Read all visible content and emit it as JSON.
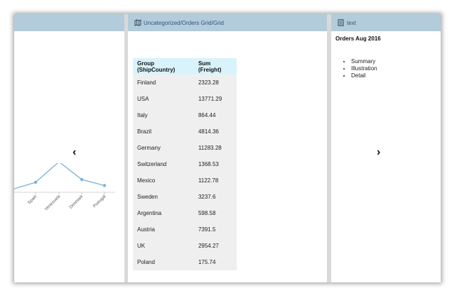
{
  "middle_panel": {
    "header_icon": "map-icon",
    "header_title": "Uncategorized/Orders Grid/Grid",
    "table": {
      "columns": [
        "Group (ShipCountry)",
        "Sum (Freight)"
      ],
      "rows": [
        [
          "Finland",
          "2323.28"
        ],
        [
          "USA",
          "13771.29"
        ],
        [
          "Italy",
          "864.44"
        ],
        [
          "Brazil",
          "4814.36"
        ],
        [
          "Germany",
          "11283.28"
        ],
        [
          "Switzerland",
          "1368.53"
        ],
        [
          "Mexico",
          "1122.78"
        ],
        [
          "Sweden",
          "3237.6"
        ],
        [
          "Argentina",
          "598.58"
        ],
        [
          "Austria",
          "7391.5"
        ],
        [
          "UK",
          "2954.27"
        ],
        [
          "Poland",
          "175.74"
        ]
      ]
    }
  },
  "right_panel": {
    "header_icon": "document-icon",
    "header_title": "text",
    "title": "Orders Aug 2016",
    "items": [
      "Summary",
      "Illustration",
      "Detail"
    ]
  },
  "navigation": {
    "prev_icon": "chevron-left-icon",
    "next_icon": "chevron-right-icon",
    "prev_glyph": "‹",
    "next_glyph": "›"
  },
  "chart_data": {
    "type": "line",
    "categories": [
      "Spain",
      "Venezuela",
      "Denmark",
      "Portugal"
    ],
    "series": [
      {
        "values": [
          0.42,
          1.0,
          0.5,
          0.33
        ]
      }
    ],
    "color": "#79b1d7",
    "grid": false
  }
}
